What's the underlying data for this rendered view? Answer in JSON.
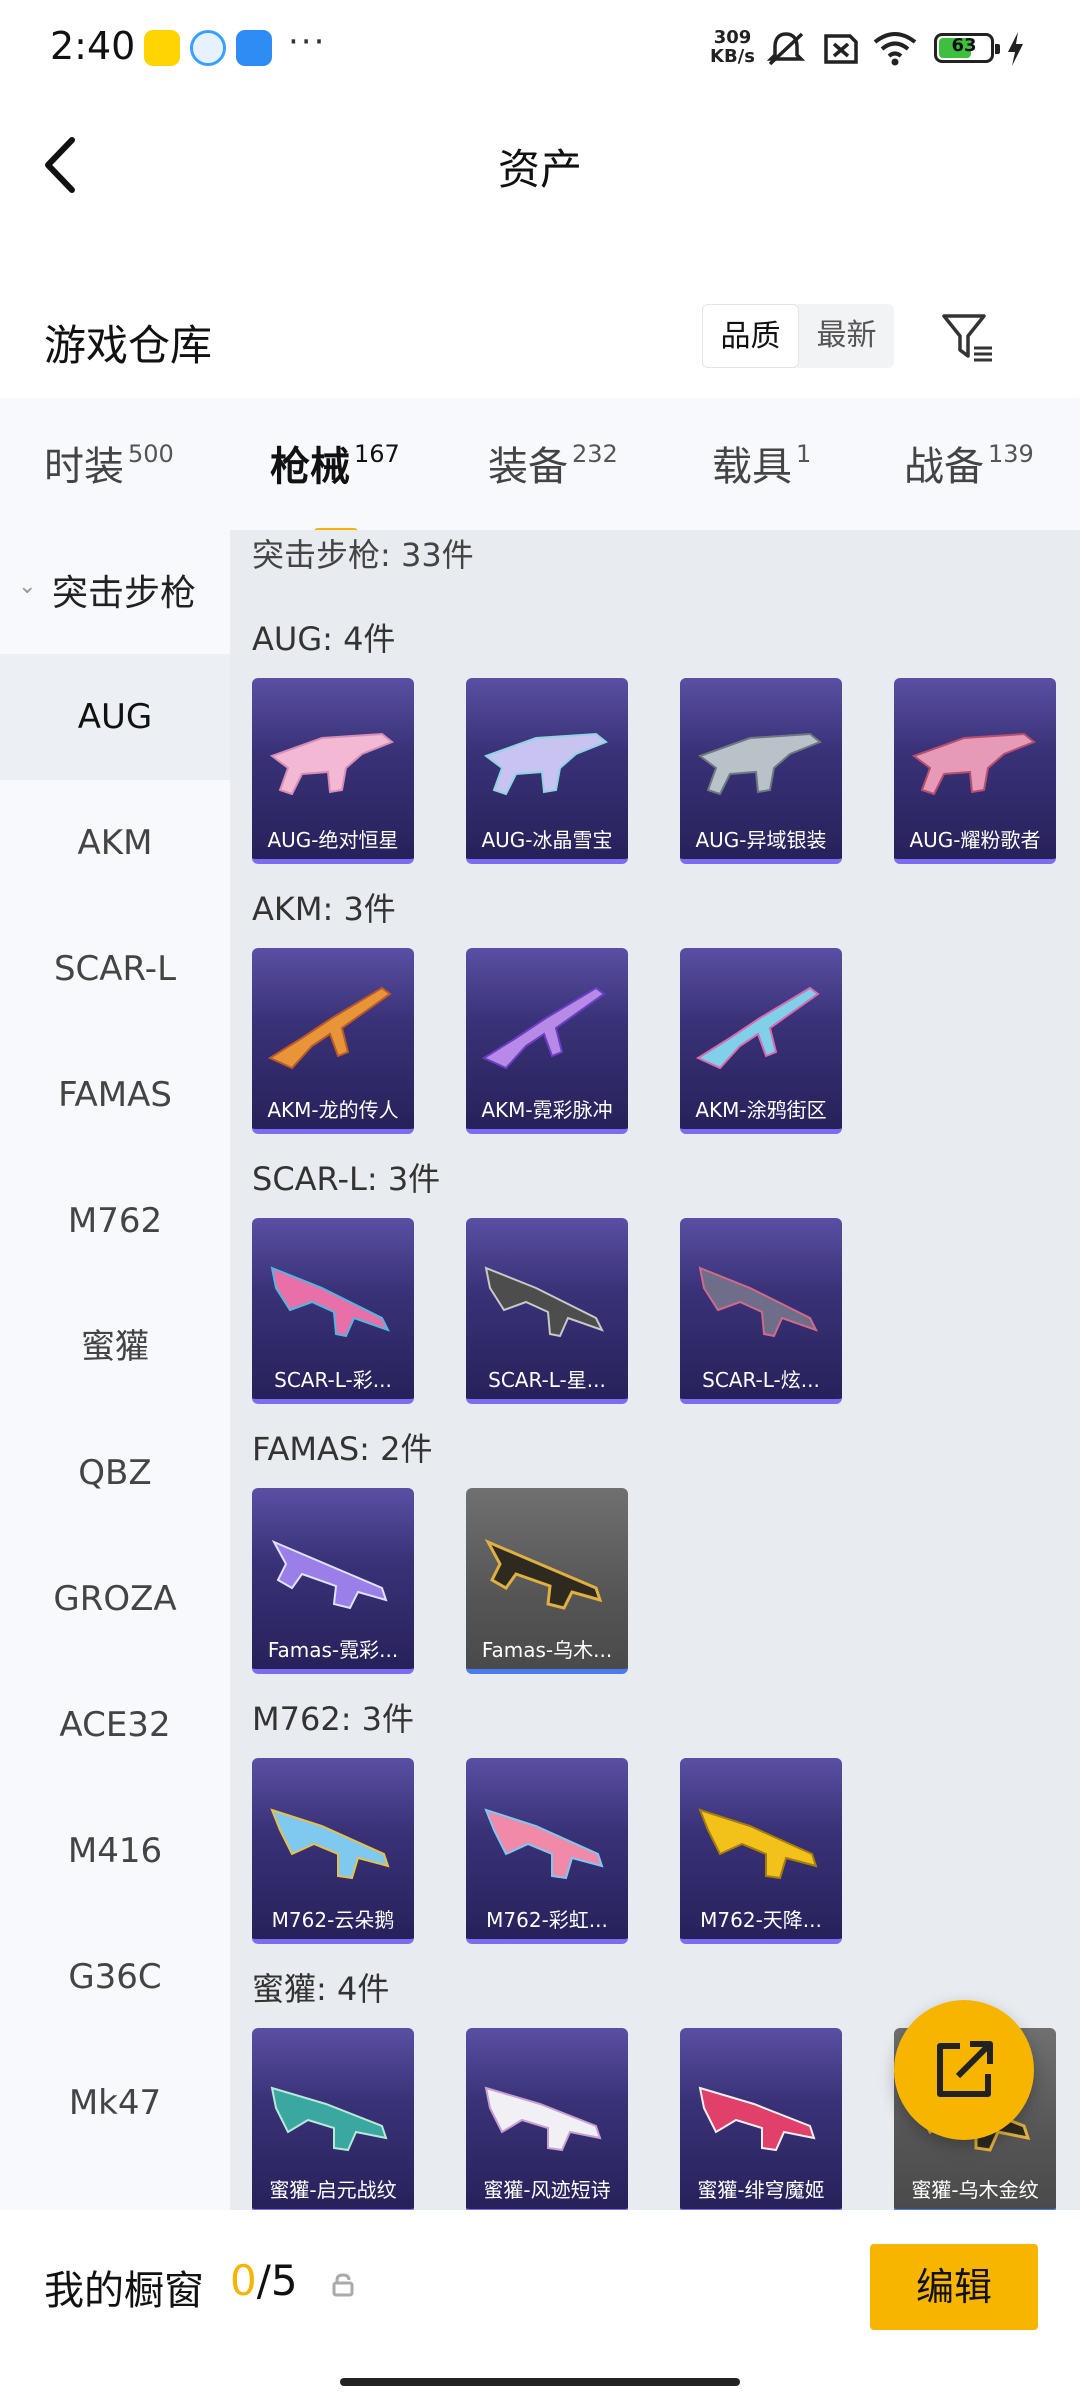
{
  "status_bar": {
    "time": "2:40",
    "net_speed_value": "309",
    "net_speed_unit": "KB/s",
    "battery": "63",
    "more": "···"
  },
  "header": {
    "title": "资产"
  },
  "warehouse": {
    "title": "游戏仓库",
    "sort_options": [
      "品质",
      "最新"
    ],
    "sort_selected": "品质"
  },
  "tabs": [
    {
      "label": "时装",
      "count": "500"
    },
    {
      "label": "枪械",
      "count": "167",
      "active": true
    },
    {
      "label": "装备",
      "count": "232"
    },
    {
      "label": "载具",
      "count": "1"
    },
    {
      "label": "战备",
      "count": "139"
    }
  ],
  "sidebar": {
    "group": "突击步枪",
    "items": [
      "AUG",
      "AKM",
      "SCAR-L",
      "FAMAS",
      "M762",
      "蜜獾",
      "QBZ",
      "GROZA",
      "ACE32",
      "M416",
      "G36C",
      "Mk47"
    ],
    "selected": "AUG"
  },
  "content": {
    "category_total": "突击步枪: 33件",
    "sections": [
      {
        "title": "AUG: 4件",
        "items": [
          "AUG-绝对恒星",
          "AUG-冰晶雪宝",
          "AUG-异域银装",
          "AUG-耀粉歌者"
        ]
      },
      {
        "title": "AKM: 3件",
        "items": [
          "AKM-龙的传人",
          "AKM-霓彩脉冲",
          "AKM-涂鸦街区"
        ]
      },
      {
        "title": "SCAR-L: 3件",
        "items": [
          "SCAR-L-彩...",
          "SCAR-L-星...",
          "SCAR-L-炫..."
        ]
      },
      {
        "title": "FAMAS: 2件",
        "items": [
          "Famas-霓彩...",
          "Famas-乌木..."
        ]
      },
      {
        "title": "M762: 3件",
        "items": [
          "M762-云朵鹅",
          "M762-彩虹...",
          "M762-天降..."
        ]
      },
      {
        "title": "蜜獾: 4件",
        "items": [
          "蜜獾-启元战纹",
          "蜜獾-风迹短诗",
          "蜜獾-绯穹魔姬",
          "蜜獾-乌木金纹"
        ]
      }
    ]
  },
  "showcase": {
    "label": "我的橱窗",
    "used": "0",
    "total": "/5"
  },
  "edit_button": "编辑",
  "colors": {
    "accent": "#f7b500",
    "card_bg": "#3a3278",
    "card_border": "#7c6cf0"
  }
}
